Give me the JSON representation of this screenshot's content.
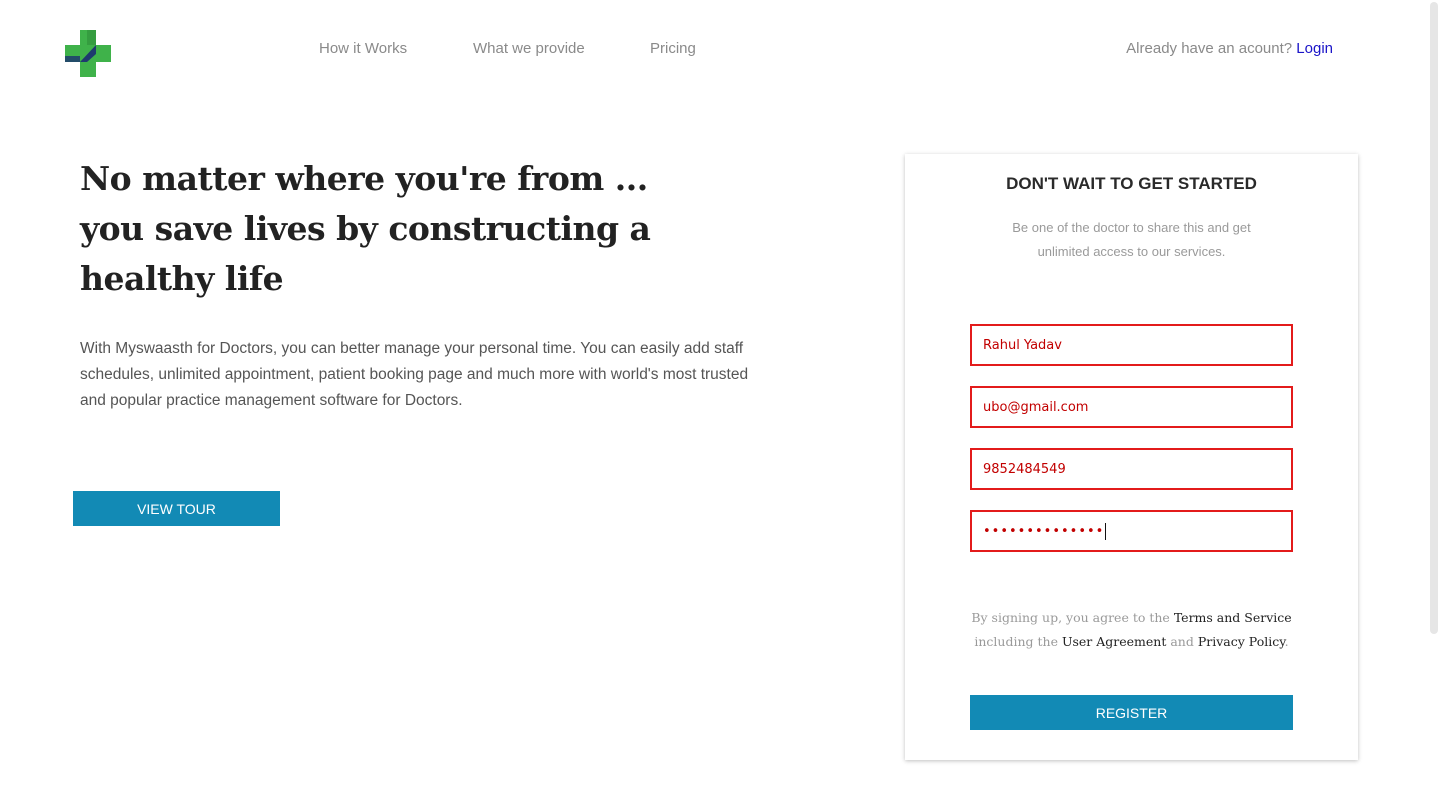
{
  "nav": {
    "items": [
      {
        "label": "How it Works"
      },
      {
        "label": "What we provide"
      },
      {
        "label": "Pricing"
      }
    ],
    "account_prompt": "Already have an acount?",
    "login_label": "Login"
  },
  "hero": {
    "title_lines": [
      "No matter where you're from ...",
      "you save lives by constructing a",
      "healthy life"
    ],
    "description": "With Myswaasth for Doctors, you can better manage your personal time. You can easily add staff schedules, unlimited appointment, patient booking page and much more with world's most trusted and popular practice management software for Doctors.",
    "tour_button": "VIEW TOUR"
  },
  "signup": {
    "title": "DON'T WAIT TO GET STARTED",
    "subtitle": "Be one of the doctor to share this and get unlimited access to our services.",
    "fields": {
      "name": "Rahul Yadav",
      "email": "ubo@gmail.com",
      "phone": "9852484549",
      "password": "••••••••••••••"
    },
    "terms": {
      "prefix": "By signing up, you agree to the",
      "terms_link": "Terms and Service",
      "middle": "including the",
      "agreement_link": "User Agreement",
      "and": "and",
      "privacy_link": "Privacy Policy",
      "suffix": "."
    },
    "register_button": "REGISTER"
  },
  "colors": {
    "accent": "#128ab5",
    "error_border": "#e31b1b",
    "login_link": "#1a14c8",
    "logo_green": "#3fb24a",
    "logo_navy": "#1e3a6e"
  },
  "icons": {
    "logo": "medical-cross-icon"
  }
}
